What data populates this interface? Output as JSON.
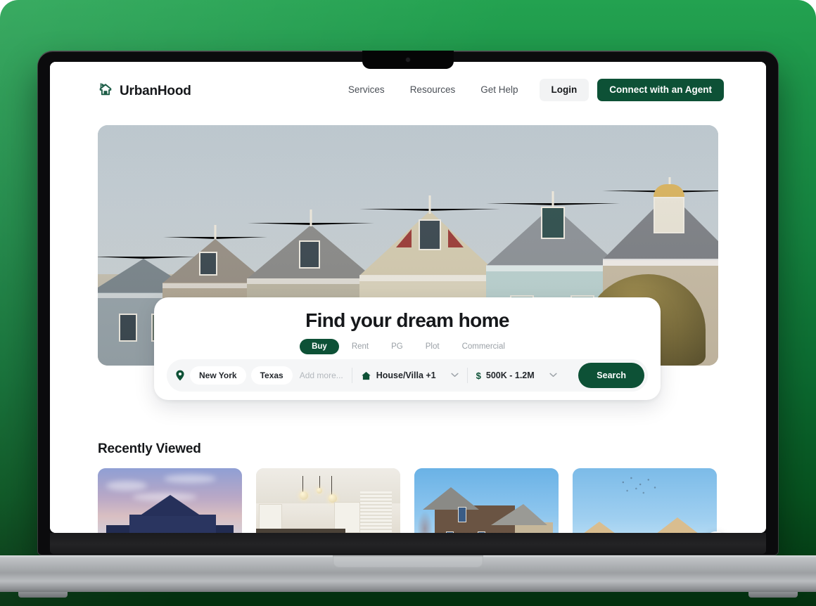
{
  "site": {
    "brand_name": "UrbanHood",
    "logo_icon": "house-logo-icon"
  },
  "nav": {
    "links": [
      {
        "label": "Services"
      },
      {
        "label": "Resources"
      },
      {
        "label": "Get Help"
      }
    ],
    "login_label": "Login",
    "agent_cta_label": "Connect with an Agent"
  },
  "hero": {
    "image_alt": "Row of Victorian painted-lady houses"
  },
  "search": {
    "title": "Find your dream home",
    "tabs": [
      {
        "label": "Buy",
        "active": true
      },
      {
        "label": "Rent",
        "active": false
      },
      {
        "label": "PG",
        "active": false
      },
      {
        "label": "Plot",
        "active": false
      },
      {
        "label": "Commercial",
        "active": false
      }
    ],
    "location_icon": "map-pin-icon",
    "location_chips": [
      "New York",
      "Texas"
    ],
    "add_more_placeholder": "Add more...",
    "property_type": {
      "icon": "home-icon",
      "value": "House/Villa +1",
      "caret": "chevron-down-icon"
    },
    "price_range": {
      "icon": "dollar-icon",
      "value": "500K - 1.2M",
      "caret": "chevron-down-icon"
    },
    "search_button_label": "Search"
  },
  "recently_viewed": {
    "title": "Recently Viewed",
    "cards": [
      {
        "alt": "Navy gabled house at dusk"
      },
      {
        "alt": "Bright white kitchen interior"
      },
      {
        "alt": "Brown craftsman house under blue sky"
      },
      {
        "alt": "Tan twin-gable rooftops under blue sky"
      }
    ],
    "next_icon": "chevron-right-icon"
  },
  "colors": {
    "brand_green": "#0d5136",
    "accent_green": "#23a250",
    "backdrop_dark": "#04300f",
    "text_primary": "#16181b",
    "text_muted": "#9aa0a6",
    "field_bg": "#f5f6f7"
  },
  "device": {
    "type": "laptop",
    "camera": "camera-dot-icon"
  }
}
